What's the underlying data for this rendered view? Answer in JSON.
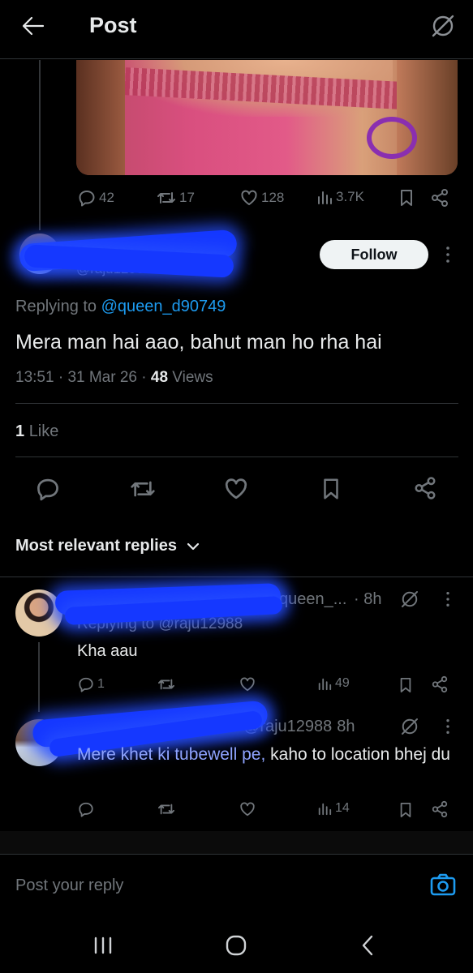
{
  "header": {
    "title": "Post"
  },
  "top_post": {
    "replies": "42",
    "reposts": "17",
    "likes": "128",
    "views": "3.7K"
  },
  "main_post": {
    "follow_label": "Follow",
    "handle_fragment": "@raju12988",
    "replying_prefix": "Replying to",
    "replying_handle": "@queen_d90749",
    "text": "Mera man hai aao, bahut man ho rha hai",
    "time": "13:51",
    "date": "31 Mar 26",
    "views_count": "48",
    "views_label": "Views",
    "likes_count": "1",
    "likes_label": "Like"
  },
  "replies_header": {
    "label": "Most relevant replies"
  },
  "reply1": {
    "handle_tail": "queen_...",
    "time": "8h",
    "replying_text": "Replying to @raju12988",
    "text": "Kha aau",
    "replies": "1",
    "views": "49"
  },
  "reply2": {
    "handle_tail": "raju12988",
    "time": "8h",
    "mention": "Mere khet ki tubewell pe,",
    "text": "kaho to location bhej du",
    "views": "14"
  },
  "composer": {
    "placeholder": "Post your reply"
  },
  "colors": {
    "accent": "#1d9bf0",
    "background": "#000000",
    "muted": "#71767b",
    "redaction": "#1538ff"
  }
}
